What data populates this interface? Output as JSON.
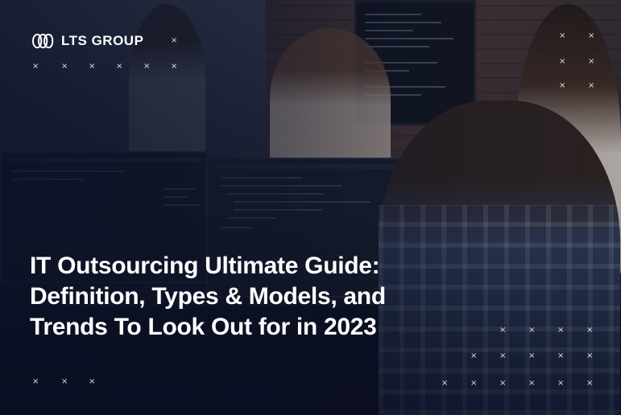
{
  "brand": {
    "name": "LTS GROUP",
    "icon": "lts-logo-icon",
    "color": "#ffffff"
  },
  "headline": {
    "lines": [
      "IT Outsourcing Ultimate Guide:",
      "Definition, Types & Models, and",
      "Trends To Look Out for in 2023"
    ],
    "color": "#ffffff"
  },
  "decoration": {
    "mark_glyph": "×",
    "overlay_color": "#0c1228"
  }
}
